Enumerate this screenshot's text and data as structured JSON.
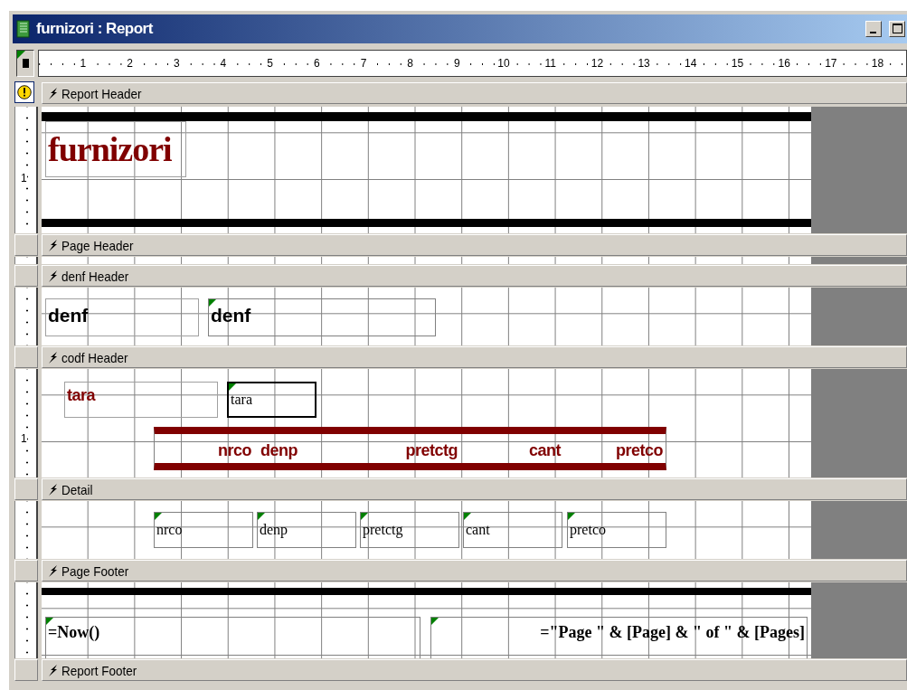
{
  "window": {
    "title": "furnizori : Report"
  },
  "ruler": {
    "marks": [
      "1",
      "2",
      "3",
      "4",
      "5",
      "6",
      "7",
      "8",
      "9",
      "10",
      "11",
      "12",
      "13",
      "14",
      "15",
      "16",
      "17",
      "18"
    ]
  },
  "sections": [
    {
      "name": "Report Header",
      "ruler_marks": [
        "1"
      ],
      "controls": [
        {
          "kind": "label",
          "text": "furnizori",
          "color": "#800000",
          "selected": false
        }
      ]
    },
    {
      "name": "Page Header"
    },
    {
      "name": "denf Header",
      "controls": [
        {
          "kind": "label",
          "text": "denf",
          "color": "#000000",
          "selected": false
        },
        {
          "kind": "textbox",
          "text": "denf",
          "color": "#000000",
          "selected": false
        }
      ]
    },
    {
      "name": "codf Header",
      "ruler_marks": [
        "1"
      ],
      "controls": [
        {
          "kind": "label",
          "text": "tara",
          "color": "#800000",
          "selected": false
        },
        {
          "kind": "textbox",
          "text": "tara",
          "color": "#000000",
          "selected": true
        },
        {
          "kind": "label",
          "text": "nrco",
          "color": "#800000",
          "selected": false
        },
        {
          "kind": "label",
          "text": "denp",
          "color": "#800000",
          "selected": false
        },
        {
          "kind": "label",
          "text": "pretctg",
          "color": "#800000",
          "selected": false
        },
        {
          "kind": "label",
          "text": "cant",
          "color": "#800000",
          "selected": false
        },
        {
          "kind": "label",
          "text": "pretco",
          "color": "#800000",
          "selected": false
        }
      ]
    },
    {
      "name": "Detail",
      "controls": [
        {
          "kind": "textbox",
          "text": "nrco",
          "color": "#000000",
          "selected": false
        },
        {
          "kind": "textbox",
          "text": "denp",
          "color": "#000000",
          "selected": false
        },
        {
          "kind": "textbox",
          "text": "pretctg",
          "color": "#000000",
          "selected": false
        },
        {
          "kind": "textbox",
          "text": "cant",
          "color": "#000000",
          "selected": false
        },
        {
          "kind": "textbox",
          "text": "pretco",
          "color": "#000000",
          "selected": false
        }
      ]
    },
    {
      "name": "Page Footer",
      "controls": [
        {
          "kind": "textbox",
          "text": "=Now()",
          "color": "#000000",
          "selected": false
        },
        {
          "kind": "textbox",
          "text": "=\"Page \" & [Page] & \" of \" & [Pages]",
          "color": "#000000",
          "selected": false
        }
      ]
    },
    {
      "name": "Report Footer"
    }
  ]
}
